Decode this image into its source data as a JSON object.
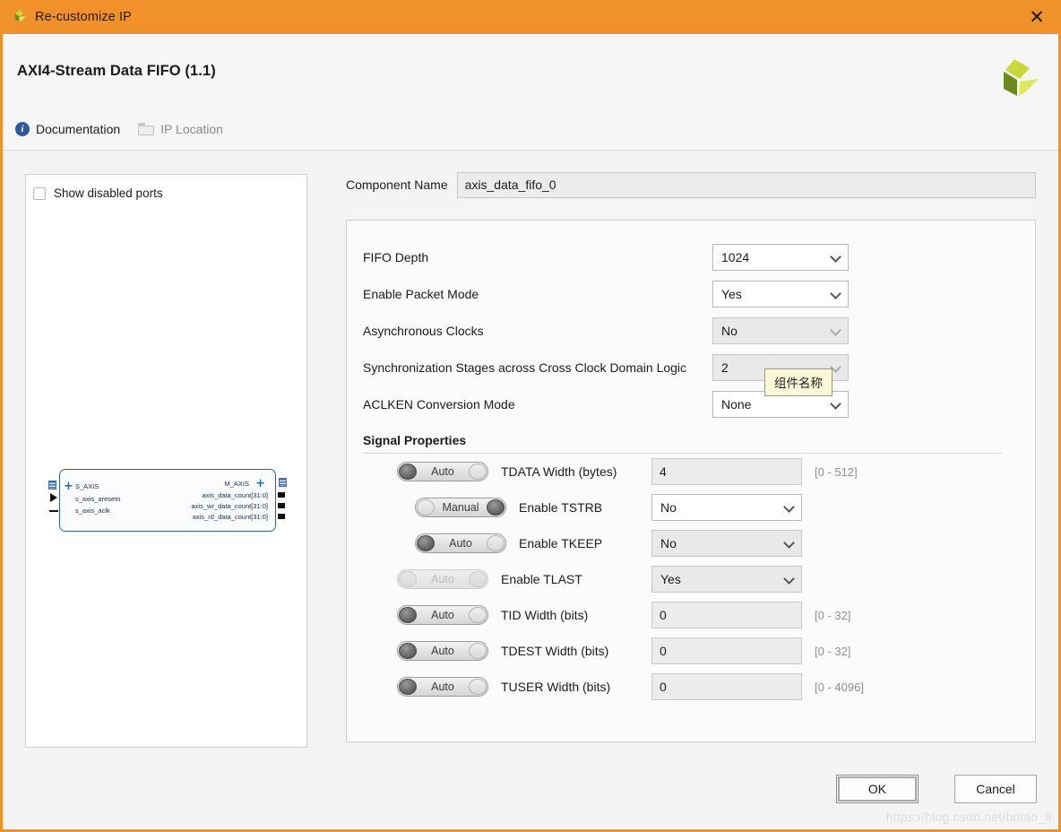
{
  "titlebar": {
    "title": "Re-customize IP",
    "icon": "xilinx-logo-icon",
    "close_label": "✕"
  },
  "header": {
    "ip_title": "AXI4-Stream Data FIFO (1.1)",
    "logo": "xilinx-logo",
    "links": [
      {
        "label": "Documentation",
        "icon": "info-icon",
        "enabled": true
      },
      {
        "label": "IP Location",
        "icon": "folder-icon",
        "enabled": false
      }
    ]
  },
  "left_panel": {
    "show_disabled_ports": {
      "label": "Show disabled ports",
      "checked": false
    },
    "diagram": {
      "left_ports": [
        {
          "name": "S_AXIS",
          "type": "bus"
        },
        {
          "name": "s_axis_aresetn",
          "type": "reset"
        },
        {
          "name": "s_axis_aclk",
          "type": "clock"
        }
      ],
      "right_ports": [
        {
          "name": "M_AXIS",
          "type": "bus"
        },
        {
          "name": "axis_data_count[31:0]",
          "type": "pin"
        },
        {
          "name": "axis_wr_data_count[31:0]",
          "type": "pin"
        },
        {
          "name": "axis_rd_data_count[31:0]",
          "type": "pin"
        }
      ]
    }
  },
  "component": {
    "label": "Component Name",
    "value": "axis_data_fifo_0"
  },
  "tooltip": {
    "text": "组件名称"
  },
  "options": [
    {
      "label": "FIFO Depth",
      "value": "1024",
      "disabled": false
    },
    {
      "label": "Enable Packet Mode",
      "value": "Yes",
      "disabled": false
    },
    {
      "label": "Asynchronous Clocks",
      "value": "No",
      "disabled": true
    },
    {
      "label": "Synchronization Stages across Cross Clock Domain Logic",
      "value": "2",
      "disabled": true
    },
    {
      "label": "ACLKEN Conversion Mode",
      "value": "None",
      "disabled": false
    }
  ],
  "signal_properties": {
    "header": "Signal Properties",
    "rows": [
      {
        "toggle": "Auto",
        "toggle_side": "left",
        "toggle_disabled": false,
        "name": "TDATA Width (bytes)",
        "field_type": "text",
        "value": "4",
        "range": "[0 - 512]"
      },
      {
        "toggle": "Manual",
        "toggle_side": "right",
        "toggle_disabled": false,
        "name": "Enable TSTRB",
        "field_type": "select",
        "value": "No",
        "range": ""
      },
      {
        "toggle": "Auto",
        "toggle_side": "left",
        "toggle_disabled": false,
        "name": "Enable TKEEP",
        "field_type": "select",
        "value": "No",
        "range": "",
        "field_disabled": true
      },
      {
        "toggle": "Auto",
        "toggle_side": "left",
        "toggle_disabled": true,
        "name": "Enable TLAST",
        "field_type": "select",
        "value": "Yes",
        "range": "",
        "field_disabled": true
      },
      {
        "toggle": "Auto",
        "toggle_side": "left",
        "toggle_disabled": false,
        "name": "TID Width (bits)",
        "field_type": "text",
        "value": "0",
        "range": "[0 - 32]"
      },
      {
        "toggle": "Auto",
        "toggle_side": "left",
        "toggle_disabled": false,
        "name": "TDEST Width (bits)",
        "field_type": "text",
        "value": "0",
        "range": "[0 - 32]"
      },
      {
        "toggle": "Auto",
        "toggle_side": "left",
        "toggle_disabled": false,
        "name": "TUSER Width (bits)",
        "field_type": "text",
        "value": "0",
        "range": "[0 - 4096]"
      }
    ]
  },
  "footer": {
    "ok_label": "OK",
    "cancel_label": "Cancel"
  },
  "watermark": "https://blog.csdn.net/botao_li",
  "colors": {
    "titlebar": "#f0912a",
    "accent_border": "#ef9424",
    "link_blue": "#2b5b9e",
    "diagram_border": "#2f5ea8",
    "tooltip_bg": "#fbf8d8"
  }
}
